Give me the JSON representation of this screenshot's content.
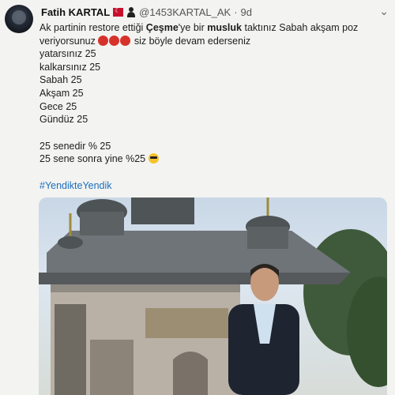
{
  "tweet": {
    "author_name": "Fatih KARTAL",
    "handle": "@1453KARTAL_AK",
    "separator": "·",
    "time": "9d",
    "menu_icon": "chevron-down-icon",
    "text": {
      "line1_pre": "Ak partinin restore ettiği ",
      "line1_bold1": "Çeşme",
      "line1_mid": "'ye bir ",
      "line1_bold2": "musluk",
      "line1_post": " taktınız Sabah akşam poz",
      "line2_pre": "veriyorsunuz ",
      "line2_post": " siz böyle devam ederseniz",
      "list": [
        "yatarsınız 25",
        "kalkarsınız 25",
        "Sabah 25",
        "Akşam 25",
        "Gece 25",
        "Gündüz 25"
      ],
      "line_after1": "25 senedir % 25",
      "line_after2": "25 sene sonra yine %25 ",
      "hashtag": "#YendikteYendik"
    },
    "emojis": [
      "angry-face-icon",
      "angry-face-icon",
      "angry-face-icon",
      "sunglasses-face-icon"
    ],
    "colors": {
      "hashtag": "#1b6fbf",
      "flag": "#c8102e"
    }
  }
}
